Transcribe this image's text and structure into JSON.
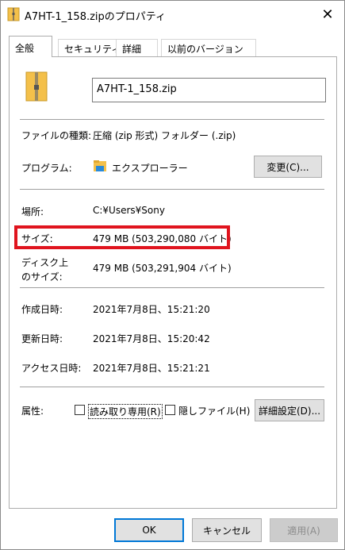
{
  "window": {
    "title": "A7HT-1_158.zipのプロパティ",
    "close_glyph": "✕"
  },
  "tabs": [
    {
      "label": "全般",
      "active": true
    },
    {
      "label": "セキュリティ",
      "active": false
    },
    {
      "label": "詳細",
      "active": false
    },
    {
      "label": "以前のバージョン",
      "active": false
    }
  ],
  "general": {
    "file_name": "A7HT-1_158.zip",
    "file_type_label": "ファイルの種類:",
    "file_type_value": "圧縮 (zip 形式) フォルダー (.zip)",
    "program_label": "プログラム:",
    "program_value": "エクスプローラー",
    "change_button": "変更(C)...",
    "location_label": "場所:",
    "location_value": "C:¥Users¥Sony",
    "size_label": "サイズ:",
    "size_value": "479 MB (503,290,080 バイト)",
    "disk_size_label_1": "ディスク上",
    "disk_size_label_2": "のサイズ:",
    "disk_size_value": "479 MB (503,291,904 バイト)",
    "created_label": "作成日時:",
    "created_value": "2021年7月8日、15:21:20",
    "modified_label": "更新日時:",
    "modified_value": "2021年7月8日、15:20:42",
    "accessed_label": "アクセス日時:",
    "accessed_value": "2021年7月8日、15:21:21",
    "attributes_label": "属性:",
    "readonly_label": "読み取り専用(R)",
    "hidden_label": "隠しファイル(H)",
    "advanced_button": "詳細設定(D)..."
  },
  "footer": {
    "ok": "OK",
    "cancel": "キャンセル",
    "apply": "適用(A)"
  },
  "colors": {
    "highlight": "#e0141e",
    "folder": "#f4c04a",
    "focus_border": "#0078d7"
  }
}
